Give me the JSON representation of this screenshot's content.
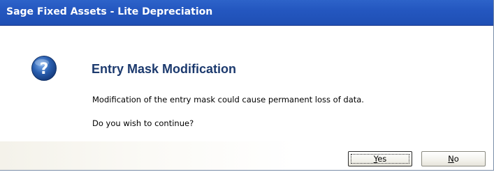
{
  "window": {
    "title": "Sage Fixed Assets - Lite Depreciation"
  },
  "dialog": {
    "icon": "question-icon",
    "heading": "Entry Mask Modification",
    "message_line1": "Modification of the entry mask could cause permanent loss of data.",
    "message_line2": "Do you wish to continue?"
  },
  "buttons": {
    "yes": {
      "accel": "Y",
      "rest": "es"
    },
    "no": {
      "accel": "N",
      "rest": "o"
    }
  },
  "colors": {
    "titlebar": "#2457c0",
    "heading": "#1c3a6e",
    "icon_blue": "#2a5fb0"
  }
}
